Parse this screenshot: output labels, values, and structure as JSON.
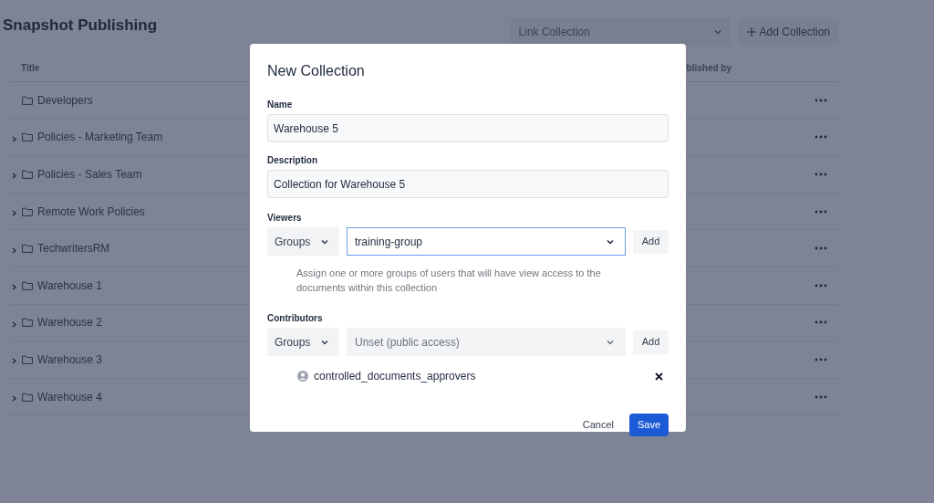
{
  "page": {
    "title": "Snapshot Publishing"
  },
  "toolbar": {
    "link_select": {
      "placeholder": "Link Collection"
    },
    "add_button": "Add Collection"
  },
  "table": {
    "columns": [
      "Title",
      "blished by"
    ],
    "rows": [
      {
        "title": "Developers",
        "expandable": false
      },
      {
        "title": "Policies - Marketing Team",
        "expandable": true
      },
      {
        "title": "Policies - Sales Team",
        "expandable": true
      },
      {
        "title": "Remote Work Policies",
        "expandable": true
      },
      {
        "title": "TechwritersRM",
        "expandable": true
      },
      {
        "title": "Warehouse 1",
        "expandable": true
      },
      {
        "title": "Warehouse 2",
        "expandable": true
      },
      {
        "title": "Warehouse 3",
        "expandable": true
      },
      {
        "title": "Warehouse 4",
        "expandable": true
      }
    ]
  },
  "dialog": {
    "title": "New Collection",
    "name": {
      "label": "Name",
      "value": "Warehouse 5"
    },
    "description": {
      "label": "Description",
      "value": "Collection for Warehouse 5"
    },
    "viewers": {
      "label": "Viewers",
      "type_select": "Groups",
      "value": "training-group",
      "focused": true,
      "add": "Add",
      "help": "Assign one or more groups of users that will have view access to the documents within this collection"
    },
    "contributors": {
      "label": "Contributors",
      "type_select": "Groups",
      "placeholder": "Unset (public access)",
      "focused": false,
      "add": "Add",
      "members": [
        {
          "name": "controlled_documents_approvers"
        }
      ]
    },
    "buttons": {
      "cancel": "Cancel",
      "save": "Save"
    }
  }
}
